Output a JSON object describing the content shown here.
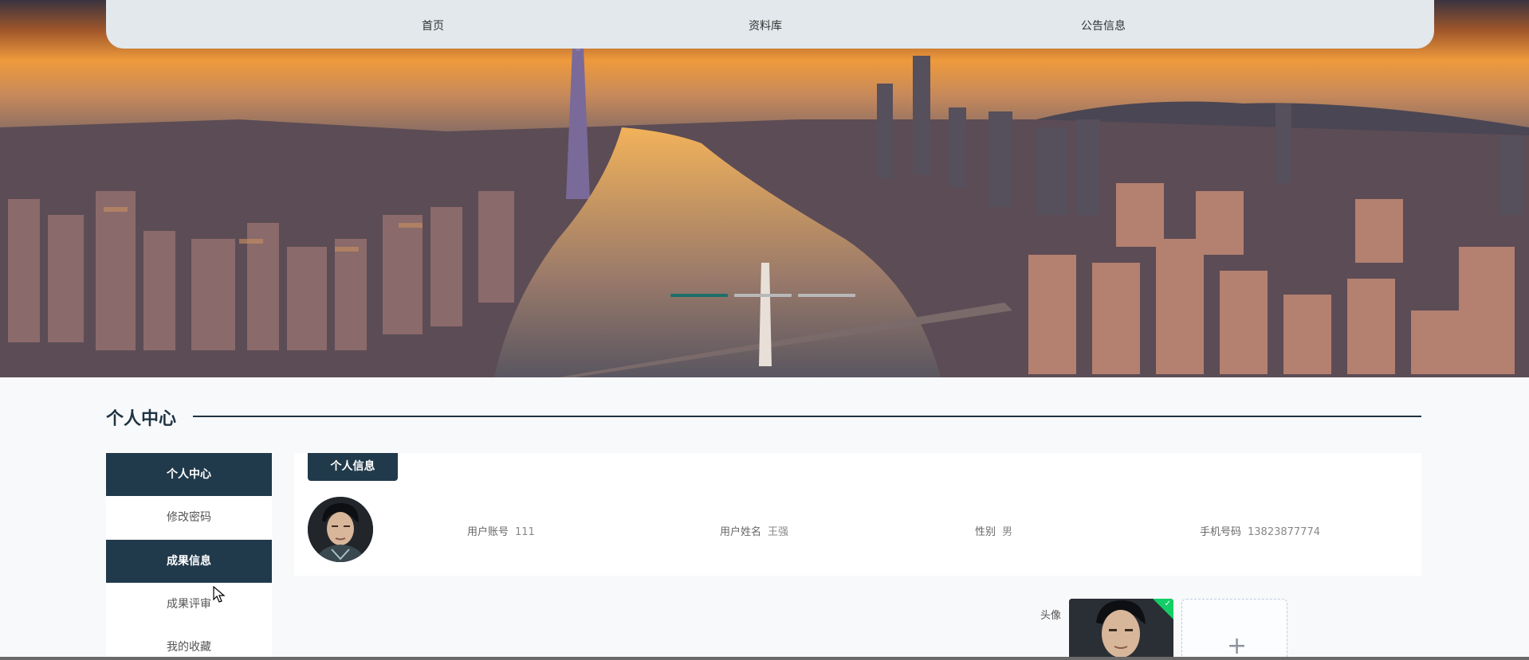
{
  "nav": {
    "items": [
      {
        "label": "首页"
      },
      {
        "label": "资料库"
      },
      {
        "label": "公告信息"
      }
    ]
  },
  "carousel": {
    "slides": 3,
    "active_index": 0
  },
  "section": {
    "title": "个人中心"
  },
  "sidebar": {
    "items": [
      {
        "label": "个人中心"
      },
      {
        "label": "修改密码"
      },
      {
        "label": "成果信息"
      },
      {
        "label": "成果评审"
      },
      {
        "label": "我的收藏"
      }
    ]
  },
  "profile": {
    "tab_label": "个人信息",
    "fields": [
      {
        "label": "用户账号",
        "value": "111"
      },
      {
        "label": "用户姓名",
        "value": "王强"
      },
      {
        "label": "性别",
        "value": "男"
      },
      {
        "label": "手机号码",
        "value": "13823877774"
      }
    ]
  },
  "upload": {
    "label": "头像",
    "add_symbol": "+"
  },
  "colors": {
    "primary": "#213a4b",
    "accent": "#1e6f6a",
    "success": "#13ce66"
  }
}
